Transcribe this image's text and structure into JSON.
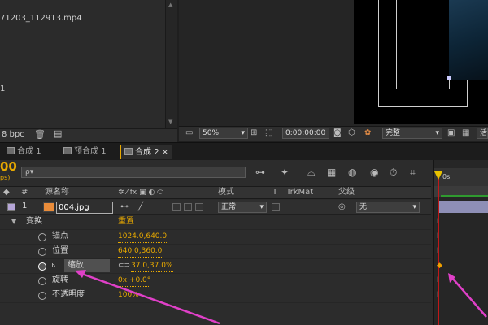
{
  "project": {
    "file_name": "71203_112913.mp4",
    "row_number": "1",
    "bpc": "8 bpc"
  },
  "viewer_toolbar": {
    "zoom": "50%",
    "timecode": "0:00:00:00",
    "quality": "完整",
    "extra": "活"
  },
  "tabs": [
    {
      "label": "合成",
      "num": "1"
    },
    {
      "label": "预合成",
      "num": "1"
    },
    {
      "label": "合成",
      "num": "2",
      "active": true
    }
  ],
  "timeline": {
    "timecode": "00",
    "fps": "ps)",
    "search_placeholder": "ρ▾",
    "ruler_label": "0s",
    "columns": {
      "index": "#",
      "source_name": "源名称",
      "mode": "模式",
      "t": "T",
      "trkmat": "TrkMat",
      "parent": "父级"
    },
    "layer": {
      "index": "1",
      "name": "004.jpg",
      "mode": "正常",
      "parent": "无",
      "label_color": "#b6a6d8"
    },
    "transform_group": {
      "label": "变换",
      "reset": "重置"
    },
    "properties": [
      {
        "name": "锚点",
        "value": "1024.0,640.0"
      },
      {
        "name": "位置",
        "value": "640.0,360.0"
      },
      {
        "name": "缩放",
        "value": "37.0,37.0%",
        "selected": true
      },
      {
        "name": "旋转",
        "value": "0x +0.0°"
      },
      {
        "name": "不透明度",
        "value": "100%"
      }
    ]
  },
  "colors": {
    "accent": "#e8a900",
    "playhead": "#c01818",
    "annotation_arrow": "#e040c8"
  }
}
